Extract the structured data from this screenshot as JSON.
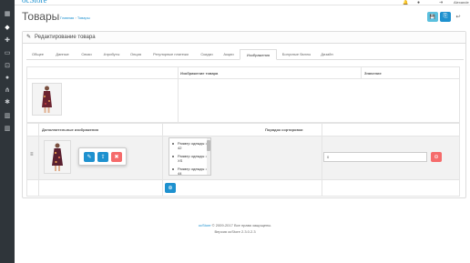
{
  "header": {
    "logo": "ocStore",
    "user_label": "Alexande",
    "icons": [
      "bell-icon",
      "user-icon",
      "sign-out-icon"
    ]
  },
  "sidebar": {
    "items": [
      {
        "icon": "dashboard-icon",
        "glyph": "▦"
      },
      {
        "icon": "tag-icon",
        "glyph": "◆",
        "active": true
      },
      {
        "icon": "puzzle-icon",
        "glyph": "✚"
      },
      {
        "icon": "desktop-icon",
        "glyph": "▭"
      },
      {
        "icon": "cart-icon",
        "glyph": "⊡"
      },
      {
        "icon": "user-icon",
        "glyph": "●"
      },
      {
        "icon": "share-icon",
        "glyph": "⋔"
      },
      {
        "icon": "cog-icon",
        "glyph": "✱"
      },
      {
        "icon": "bar-chart-icon",
        "glyph": "▥"
      },
      {
        "icon": "bar-chart-icon-2",
        "glyph": "▥"
      }
    ]
  },
  "page": {
    "title": "Товары",
    "breadcrumbs": [
      "Главная",
      "Товары"
    ],
    "breadcrumb_sep": "›",
    "buttons": {
      "save": "💾",
      "copy": "⎘",
      "back": "↩"
    },
    "colors": {
      "primary": "#1e91cf",
      "danger": "#f56b6b"
    }
  },
  "panel": {
    "heading": "Редактирование товара",
    "tabs": [
      "Общее",
      "Данные",
      "Связи",
      "Атрибуты",
      "Опция",
      "Регулярные платежи",
      "Скидки",
      "Акции",
      "Изображения",
      "Бонусные баллы",
      "Дизайн"
    ],
    "active_tab": "Изображения"
  },
  "main_image": {
    "col_image": "Изображение товара",
    "col_value": "Значение"
  },
  "additional": {
    "col_image": "Дополнительные изображения",
    "col_sort": "Порядок сортировки",
    "row": {
      "drag": "≡",
      "options": [
        "Размер одежды > 42",
        "Размер одежды > XS",
        "Размер одежды > 44"
      ],
      "sort_value": "0"
    }
  },
  "footer": {
    "brand": "ocStore",
    "copyright": "© 2009-2017 Все права защищены.",
    "version": "Версия ocStore 2.3.0.2.3"
  }
}
